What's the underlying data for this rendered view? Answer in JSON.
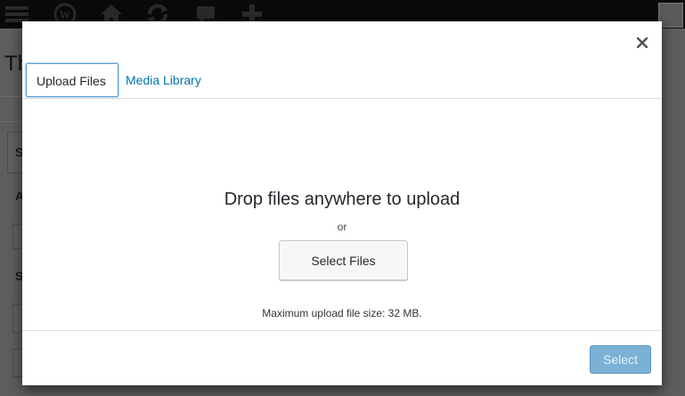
{
  "background": {
    "page_title_fragment": "Th",
    "section_letters": [
      "S",
      "A",
      "S"
    ],
    "adminbar_icons": [
      "menu-icon",
      "wordpress-logo-icon",
      "home-icon",
      "updates-icon",
      "comments-icon",
      "new-content-icon",
      "avatar"
    ]
  },
  "modal": {
    "tabs": [
      {
        "label": "Upload Files",
        "active": true
      },
      {
        "label": "Media Library",
        "active": false
      }
    ],
    "uploader": {
      "drop_text": "Drop files anywhere to upload",
      "or_text": "or",
      "select_files_label": "Select Files",
      "max_size_text": "Maximum upload file size: 32 MB."
    },
    "footer": {
      "select_label": "Select",
      "select_disabled": true
    },
    "close_icon": "close-icon"
  },
  "colors": {
    "accent_link": "#0073aa",
    "primary_button_disabled": "#7ab1d5",
    "overlay_dim": "#595959"
  }
}
